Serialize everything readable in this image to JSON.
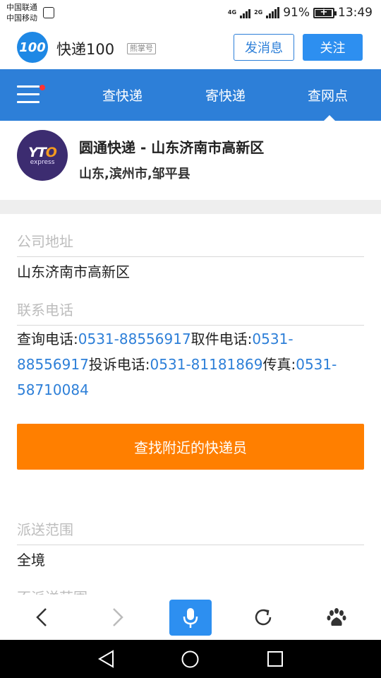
{
  "status_bar": {
    "carrier1": "中国联通",
    "carrier2": "中国移动",
    "net1": "4G",
    "net2": "2G",
    "battery": "91%",
    "time": "13:49"
  },
  "header": {
    "logo_text": "100",
    "brand": "快递100",
    "badge": "熊掌号",
    "msg_button": "发消息",
    "follow_button": "关注"
  },
  "nav": {
    "tabs": [
      "查快递",
      "寄快递",
      "查网点"
    ],
    "active_tab": "查网点"
  },
  "company": {
    "logo_text_a": "YT",
    "logo_text_b": "O",
    "logo_sub": "express",
    "title": "圆通快递 - 山东济南市高新区",
    "region": "山东,滨州市,邹平县"
  },
  "details": {
    "address_label": "公司地址",
    "address_value": "山东济南市高新区",
    "phone_label": "联系电话",
    "phone_segments": [
      {
        "text": "查询电话:",
        "type": "text"
      },
      {
        "text": "0531-88556917",
        "type": "num"
      },
      {
        "text": "取件电话:",
        "type": "text"
      },
      {
        "text": "0531-88556917",
        "type": "num"
      },
      {
        "text": "投诉电话:",
        "type": "text"
      },
      {
        "text": "0531-81181869",
        "type": "num"
      },
      {
        "text": "传真:",
        "type": "text"
      },
      {
        "text": "0531-58710084",
        "type": "num"
      }
    ],
    "find_button": "查找附近的快递员",
    "scope_label": "派送范围",
    "scope_value": "全境",
    "no_scope_label": "不派送范围"
  },
  "colors": {
    "brand_blue": "#2d7fd8",
    "accent_orange": "#ff7f00",
    "yto_purple": "#3c2c70"
  }
}
